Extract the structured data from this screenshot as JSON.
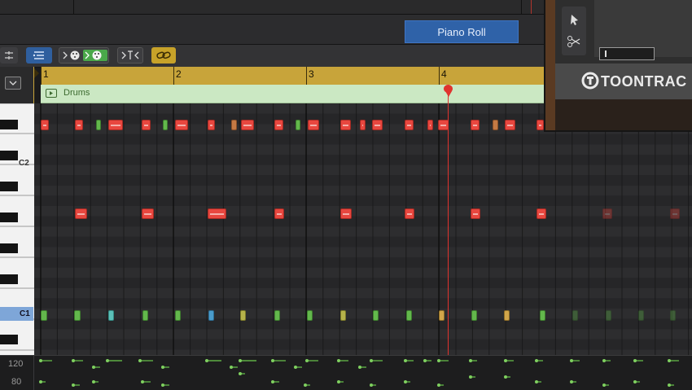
{
  "header": {
    "tab_label": "Piano Roll"
  },
  "ruler": {
    "bars": [
      "1",
      "2",
      "3",
      "4"
    ]
  },
  "region": {
    "name": "Drums"
  },
  "keyboard": {
    "labels": [
      "C2",
      "C1"
    ]
  },
  "velocity": {
    "labels": [
      "120",
      "80"
    ]
  },
  "plugin": {
    "brand": "TOONTRAC"
  },
  "colors": {
    "tab_blue": "#2f62a8",
    "ruler_gold": "#c8a43a",
    "region_green": "#cbe8c3",
    "playhead": "#e0332e",
    "note_red": "#e8473f",
    "note_green": "#63b84c"
  },
  "playhead_bar_position": 4.08
}
